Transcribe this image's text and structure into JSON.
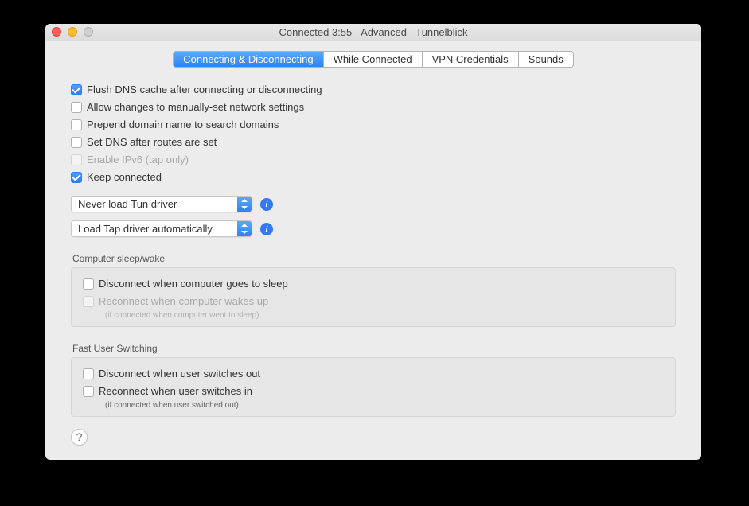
{
  "window": {
    "title": "Connected 3:55 - Advanced - Tunnelblick"
  },
  "tabs": [
    "Connecting & Disconnecting",
    "While Connected",
    "VPN Credentials",
    "Sounds"
  ],
  "checkboxes": {
    "flush_dns": "Flush DNS cache after connecting or disconnecting",
    "allow_changes": "Allow changes to manually-set network settings",
    "prepend_domain": "Prepend domain name to search domains",
    "set_dns_after": "Set DNS after routes are set",
    "enable_ipv6": "Enable IPv6 (tap only)",
    "keep_connected": "Keep connected"
  },
  "selects": {
    "tun_driver": "Never load Tun driver",
    "tap_driver": "Load Tap driver automatically"
  },
  "groups": {
    "sleep": {
      "label": "Computer sleep/wake",
      "disconnect": "Disconnect when computer goes to sleep",
      "reconnect": "Reconnect when computer wakes up",
      "hint": "(if connected when computer went to sleep)"
    },
    "fus": {
      "label": "Fast User Switching",
      "disconnect": "Disconnect when user switches out",
      "reconnect": "Reconnect when user switches in",
      "hint": "(if connected when user switched out)"
    }
  },
  "help": "?"
}
